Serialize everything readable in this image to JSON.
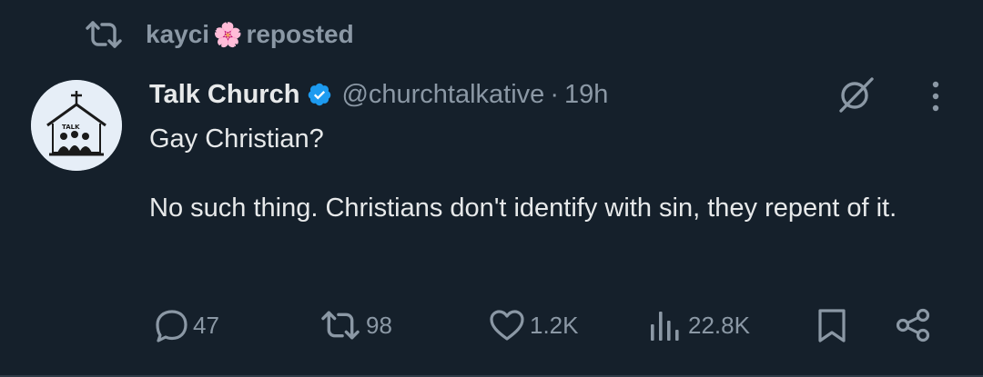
{
  "repost": {
    "user": "kayci",
    "emoji": "🌸",
    "label": "reposted",
    "icon": "repost-icon"
  },
  "tweet": {
    "author_name": "Talk Church",
    "handle": "@churchtalkative",
    "separator": "·",
    "time": "19h",
    "avatar_text": "TALK",
    "lines": [
      "Gay Christian?",
      "No such thing. Christians don't identify with sin, they repent of it."
    ]
  },
  "actions": {
    "replies": "47",
    "reposts": "98",
    "likes": "1.2K",
    "views": "22.8K"
  },
  "colors": {
    "background": "#15202b",
    "text": "#e7e9ea",
    "muted": "#8b98a5",
    "verified": "#1d9bf0"
  }
}
